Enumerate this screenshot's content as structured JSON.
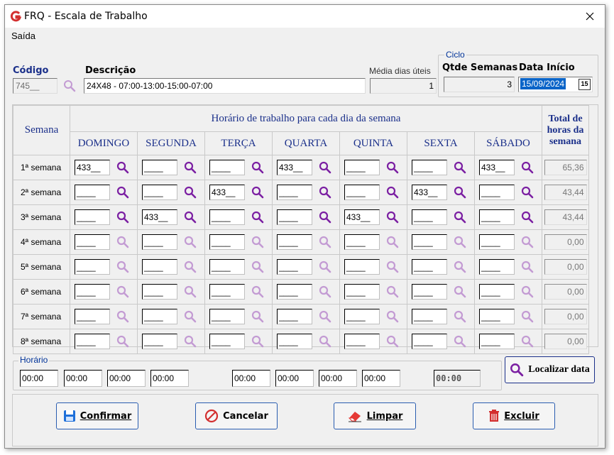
{
  "window": {
    "title": "FRQ - Escala de Trabalho",
    "close_glyph": "✕"
  },
  "menu": {
    "saida": "Saída"
  },
  "header": {
    "codigo_label": "Código",
    "codigo_value": "745__",
    "descricao_label": "Descrição",
    "descricao_value": "24X48 - 07:00-13:00-15:00-07:00",
    "media_label": "Média dias úteis",
    "media_value": "1",
    "ciclo_title": "Ciclo",
    "qtde_label": "Qtde Semanas",
    "qtde_value": "3",
    "data_inicio_label": "Data Início",
    "data_inicio_value": "15/09/2024",
    "calendar_glyph": "15"
  },
  "grid": {
    "semana_header": "Semana",
    "top_header": "Horário de trabalho para cada dia da semana",
    "total_header": "Total de horas da semana",
    "days": [
      "DOMINGO",
      "SEGUNDA",
      "TERÇA",
      "QUARTA",
      "QUINTA",
      "SEXTA",
      "SÁBADO"
    ],
    "rows": [
      {
        "label": "1ª semana",
        "cells": [
          "433__",
          "____",
          "____",
          "433__",
          "____",
          "____",
          "433__"
        ],
        "total": "65,36",
        "active": true
      },
      {
        "label": "2ª semana",
        "cells": [
          "____",
          "____",
          "433__",
          "____",
          "____",
          "433__",
          "____"
        ],
        "total": "43,44",
        "active": true
      },
      {
        "label": "3ª semana",
        "cells": [
          "____",
          "433__",
          "____",
          "____",
          "433__",
          "____",
          "____"
        ],
        "total": "43,44",
        "active": true
      },
      {
        "label": "4ª semana",
        "cells": [
          "____",
          "____",
          "____",
          "____",
          "____",
          "____",
          "____"
        ],
        "total": "0,00",
        "active": false
      },
      {
        "label": "5ª semana",
        "cells": [
          "____",
          "____",
          "____",
          "____",
          "____",
          "____",
          "____"
        ],
        "total": "0,00",
        "active": false
      },
      {
        "label": "6ª semana",
        "cells": [
          "____",
          "____",
          "____",
          "____",
          "____",
          "____",
          "____"
        ],
        "total": "0,00",
        "active": false
      },
      {
        "label": "7ª semana",
        "cells": [
          "____",
          "____",
          "____",
          "____",
          "____",
          "____",
          "____"
        ],
        "total": "0,00",
        "active": false
      },
      {
        "label": "8ª semana",
        "cells": [
          "____",
          "____",
          "____",
          "____",
          "____",
          "____",
          "____"
        ],
        "total": "0,00",
        "active": false
      }
    ]
  },
  "horario": {
    "title": "Horário",
    "fields": [
      "00:00",
      "00:00",
      "00:00",
      "00:00",
      "00:00",
      "00:00",
      "00:00",
      "00:00"
    ],
    "extra": "00:00"
  },
  "buttons": {
    "localizar": "Localizar data",
    "confirmar": "Confirmar",
    "cancelar": "Cancelar",
    "limpar": "Limpar",
    "excluir": "Excluir"
  },
  "colors": {
    "search_active": "#7b1fa2",
    "search_inactive": "#c39bd3",
    "header_text": "#1a2f8a",
    "label_blue": "#1a2f8a",
    "accent_red": "#d32f2f"
  }
}
